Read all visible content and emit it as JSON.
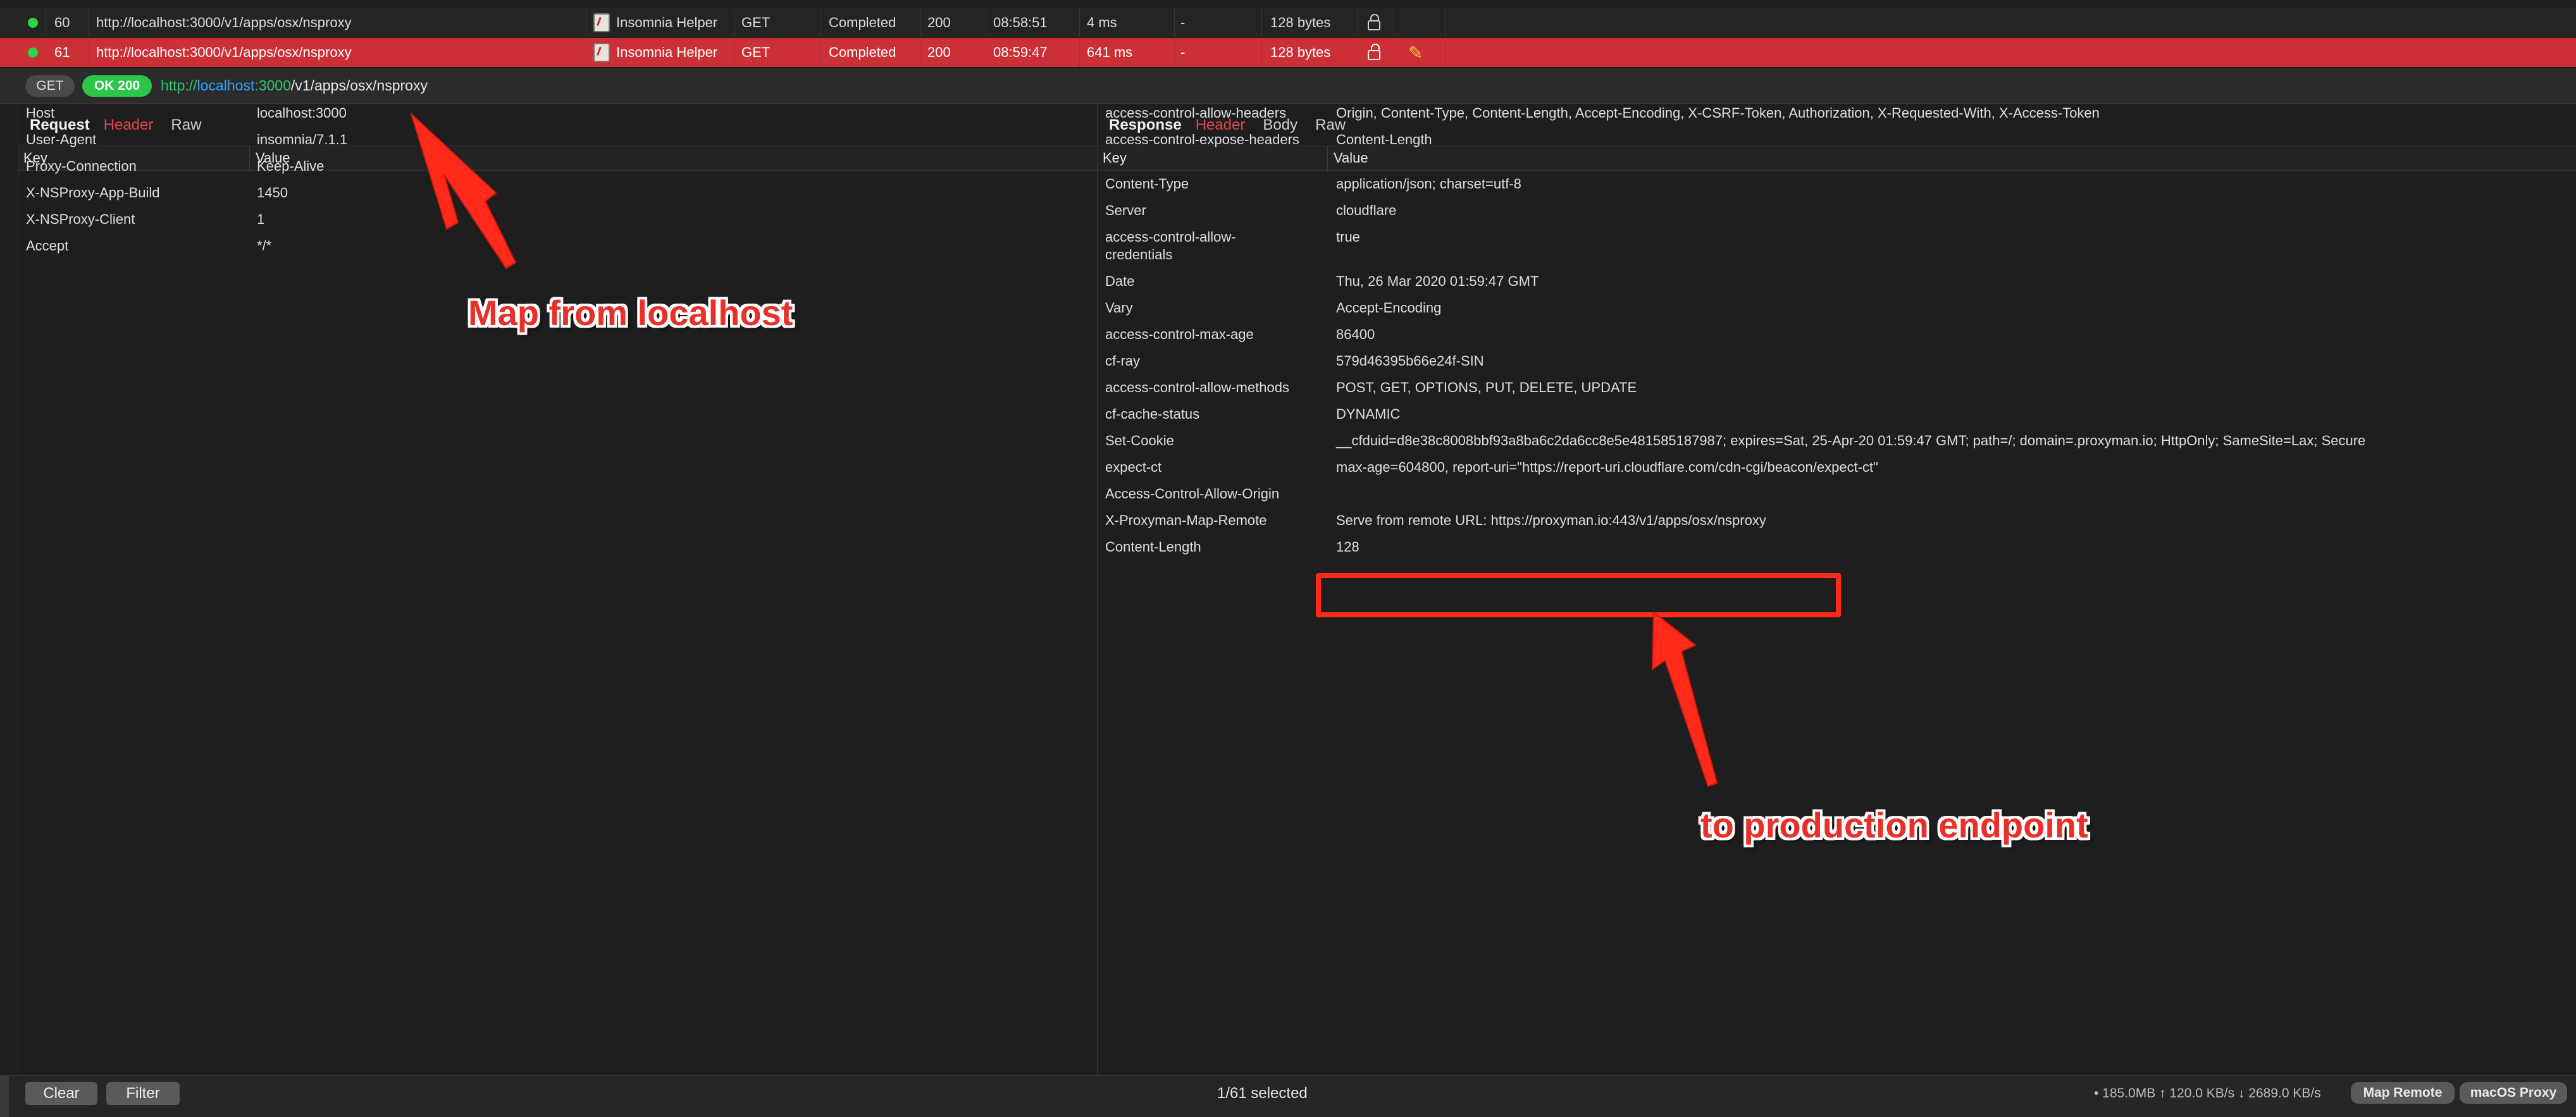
{
  "request_list": [
    {
      "id": "60",
      "url": "http://localhost:3000/v1/apps/osx/nsproxy",
      "client": "Insomnia Helper",
      "method": "GET",
      "status": "Completed",
      "code": "200",
      "time": "08:58:51",
      "duration": "4 ms",
      "extra": "-",
      "size": "128 bytes",
      "selected": false
    },
    {
      "id": "61",
      "url": "http://localhost:3000/v1/apps/osx/nsproxy",
      "client": "Insomnia Helper",
      "method": "GET",
      "status": "Completed",
      "code": "200",
      "time": "08:59:47",
      "duration": "641 ms",
      "extra": "-",
      "size": "128 bytes",
      "selected": true
    }
  ],
  "url_bar": {
    "method": "GET",
    "status": "OK 200",
    "scheme": "http://",
    "host": "localhost",
    "port": ":3000",
    "path": "/v1/apps/osx/nsproxy"
  },
  "request_pane": {
    "title": "Request",
    "tabs": [
      "Header",
      "Raw"
    ],
    "active_tab": "Header",
    "key_header": "Key",
    "value_header": "Value",
    "headers": [
      {
        "key": "Host",
        "value": "localhost:3000"
      },
      {
        "key": "User-Agent",
        "value": "insomnia/7.1.1"
      },
      {
        "key": "Proxy-Connection",
        "value": "Keep-Alive"
      },
      {
        "key": "X-NSProxy-App-Build",
        "value": "1450"
      },
      {
        "key": "X-NSProxy-Client",
        "value": "1"
      },
      {
        "key": "Accept",
        "value": "*/*"
      }
    ]
  },
  "response_pane": {
    "title": "Response",
    "tabs": [
      "Header",
      "Body",
      "Raw"
    ],
    "active_tab": "Header",
    "key_header": "Key",
    "value_header": "Value",
    "headers": [
      {
        "key": "access-control-allow-headers",
        "value": "Origin, Content-Type, Content-Length, Accept-Encoding, X-CSRF-Token, Authorization, X-Requested-With, X-Access-Token"
      },
      {
        "key": "access-control-expose-headers",
        "value": "Content-Length"
      },
      {
        "key": "",
        "value": ""
      },
      {
        "key": "Content-Type",
        "value": "application/json; charset=utf-8"
      },
      {
        "key": "Server",
        "value": "cloudflare"
      },
      {
        "key": "access-control-allow-",
        "key2": "credentials",
        "value": "true"
      },
      {
        "key": "Date",
        "value": "Thu, 26 Mar 2020 01:59:47 GMT"
      },
      {
        "key": "Vary",
        "value": "Accept-Encoding"
      },
      {
        "key": "access-control-max-age",
        "value": "86400"
      },
      {
        "key": "cf-ray",
        "value": "579d46395b66e24f-SIN"
      },
      {
        "key": "access-control-allow-methods",
        "value": "POST, GET, OPTIONS, PUT, DELETE, UPDATE"
      },
      {
        "key": "cf-cache-status",
        "value": "DYNAMIC"
      },
      {
        "key": "Set-Cookie",
        "value": "__cfduid=d8e38c8008bbf93a8ba6c2da6cc8e5e481585187987; expires=Sat, 25-Apr-20 01:59:47 GMT; path=/; domain=.proxyman.io; HttpOnly; SameSite=Lax; Secure"
      },
      {
        "key": "expect-ct",
        "value": "max-age=604800, report-uri=\"https://report-uri.cloudflare.com/cdn-cgi/beacon/expect-ct\""
      },
      {
        "key": "Access-Control-Allow-Origin",
        "value": ""
      },
      {
        "key": "X-Proxyman-Map-Remote",
        "value": "Serve from remote URL: https://proxyman.io:443/v1/apps/osx/nsproxy"
      },
      {
        "key": "Content-Length",
        "value": "128"
      }
    ]
  },
  "bottom_bar": {
    "clear_label": "Clear",
    "filter_label": "Filter",
    "selection": "1/61 selected",
    "stats": "• 185.0MB ↑ 120.0 KB/s ↓ 2689.0 KB/s",
    "map_remote_label": "Map Remote",
    "macos_proxy_label": "macOS Proxy"
  },
  "annotations": {
    "top_note": "Map from localhost",
    "bottom_note": "to production endpoint",
    "color": "#e8302a"
  }
}
